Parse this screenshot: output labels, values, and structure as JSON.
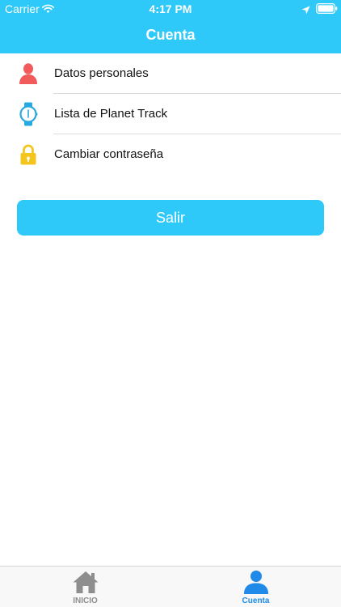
{
  "status_bar": {
    "carrier": "Carrier",
    "time": "4:17 PM",
    "icons": [
      "wifi-icon",
      "location-arrow-icon",
      "battery-icon"
    ]
  },
  "nav": {
    "title": "Cuenta"
  },
  "menu": {
    "items": [
      {
        "label": "Datos personales",
        "icon": "person-icon",
        "icon_color": "#f25b5b"
      },
      {
        "label": "Lista de Planet Track",
        "icon": "watch-icon",
        "icon_color": "#28a9e0"
      },
      {
        "label": "Cambiar contraseña",
        "icon": "lock-icon",
        "icon_color": "#f4c51c"
      }
    ]
  },
  "logout": {
    "label": "Salir"
  },
  "tab_bar": {
    "tabs": [
      {
        "label": "INICIO",
        "icon": "home-icon",
        "active": false
      },
      {
        "label": "Cuenta",
        "icon": "account-icon",
        "active": true
      }
    ]
  },
  "colors": {
    "primary": "#2ec9f8",
    "tab_active": "#1f8ae8",
    "tab_inactive": "#8e8e8e"
  }
}
